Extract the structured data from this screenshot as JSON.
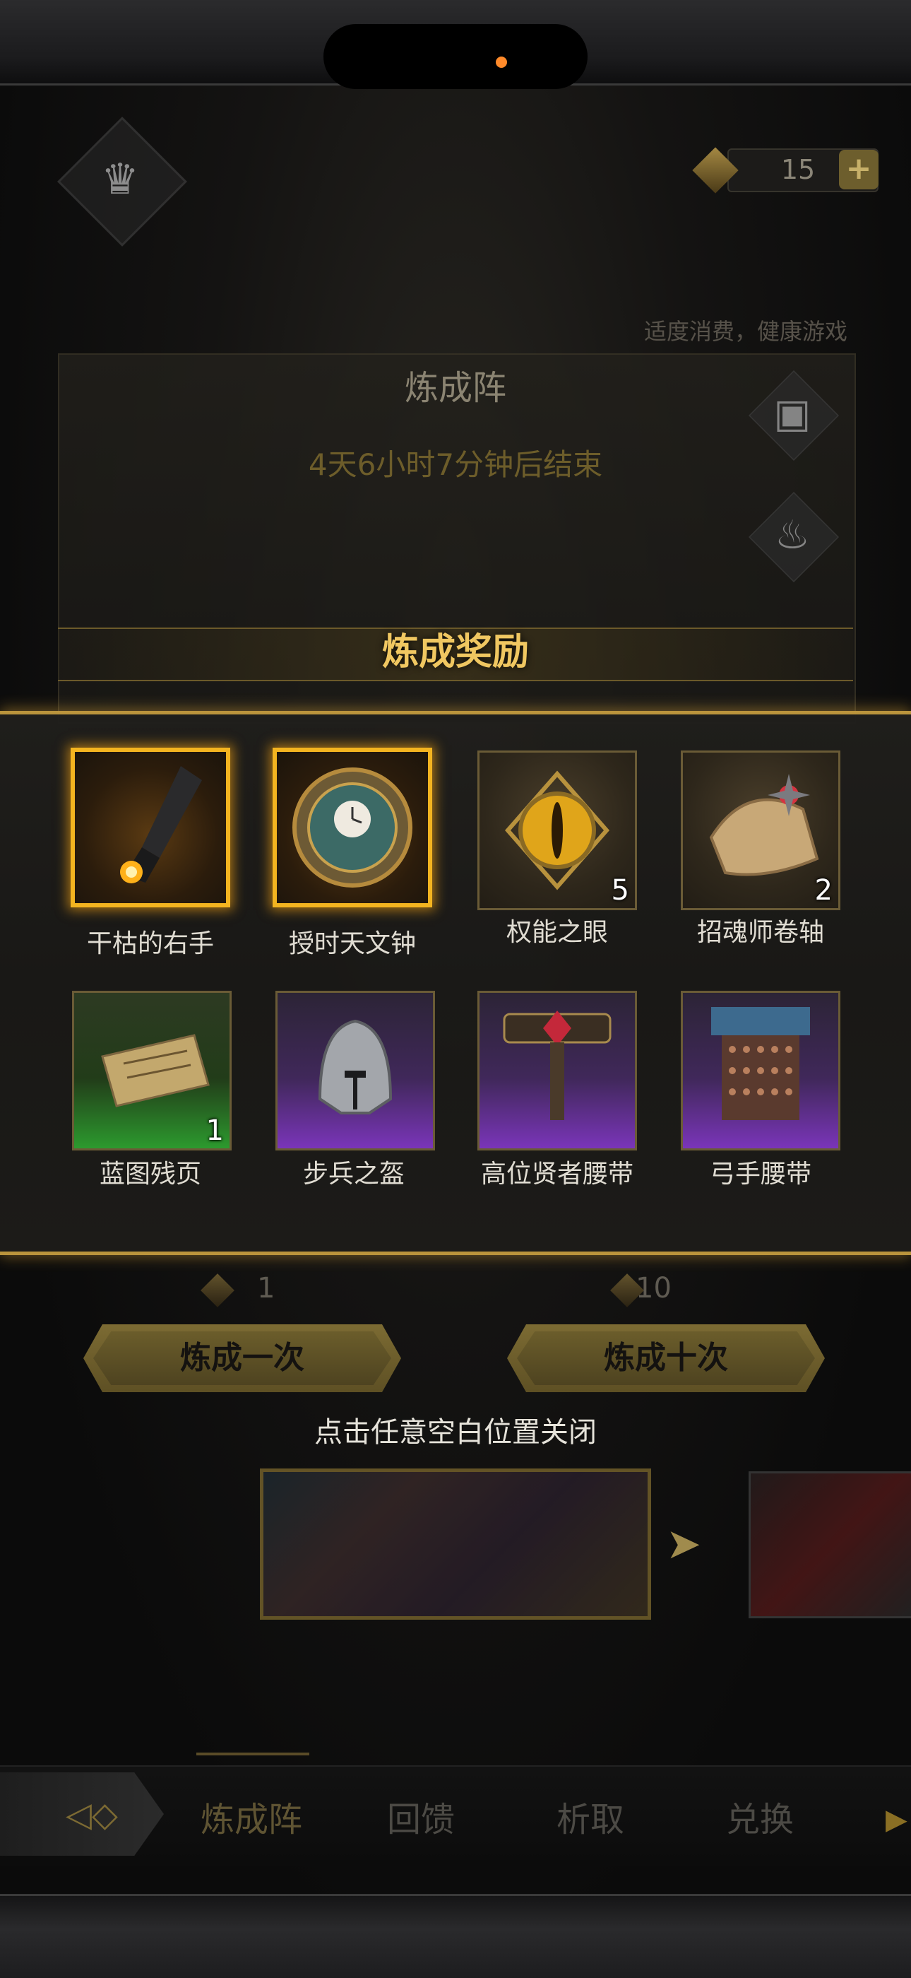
{
  "status": {
    "currency_amount": "15",
    "plus_label": "+"
  },
  "notice": "适度消费，健康游戏",
  "event": {
    "title": "炼成阵",
    "countdown": "4天6小时7分钟后结束"
  },
  "reward_panel": {
    "title": "炼成奖励",
    "items": [
      {
        "label": "干枯的右手",
        "count": "",
        "rarity": "gold",
        "icon": "withered-hand-icon"
      },
      {
        "label": "授时天文钟",
        "count": "",
        "rarity": "gold",
        "icon": "astronomical-clock-icon"
      },
      {
        "label": "权能之眼",
        "count": "5",
        "rarity": "brown",
        "icon": "eye-of-authority-icon"
      },
      {
        "label": "招魂师卷轴",
        "count": "2",
        "rarity": "brown",
        "icon": "necromancer-scroll-icon"
      },
      {
        "label": "蓝图残页",
        "count": "1",
        "rarity": "green",
        "icon": "blueprint-fragment-icon"
      },
      {
        "label": "步兵之盔",
        "count": "",
        "rarity": "purple",
        "icon": "infantry-helmet-icon"
      },
      {
        "label": "高位贤者腰带",
        "count": "",
        "rarity": "purple",
        "icon": "sage-belt-icon"
      },
      {
        "label": "弓手腰带",
        "count": "",
        "rarity": "purple",
        "icon": "archer-belt-icon"
      }
    ]
  },
  "actions": {
    "single": {
      "cost": "1",
      "label": "炼成一次"
    },
    "ten": {
      "cost": "10",
      "label": "炼成十次"
    }
  },
  "close_hint": "点击任意空白位置关闭",
  "nav": {
    "tabs": [
      "炼成阵",
      "回馈",
      "析取",
      "兑换"
    ],
    "active_index": 0
  },
  "colors": {
    "accent_gold": "#f3b420",
    "title_gold": "#f0c761",
    "rarity_green": "#2c9a2e",
    "rarity_purple": "#7a35b9"
  }
}
